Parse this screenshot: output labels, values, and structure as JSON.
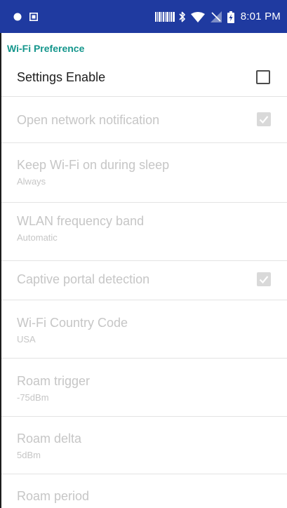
{
  "status_bar": {
    "time": "8:01 PM",
    "icons": [
      "notification-dot-icon",
      "screenshot-icon",
      "barcode-scanner-icon",
      "bluetooth-icon",
      "wifi-icon",
      "no-signal-icon",
      "battery-charging-icon"
    ]
  },
  "colors": {
    "status_bar": "#1f3aa0",
    "accent": "#14968c",
    "disabled_text": "#c6c6c6",
    "primary_text": "#1d1d1d"
  },
  "section": {
    "header": "Wi-Fi Preference"
  },
  "settings_enable": {
    "label": "Settings Enable",
    "checked": false
  },
  "preferences": {
    "open_network_notification": {
      "title": "Open network notification",
      "checked": true,
      "enabled": false
    },
    "keep_wifi_on": {
      "title": "Keep Wi-Fi on during sleep",
      "summary": "Always",
      "enabled": false
    },
    "wlan_frequency_band": {
      "title": "WLAN frequency band",
      "summary": "Automatic",
      "enabled": false
    },
    "captive_portal_detection": {
      "title": "Captive portal detection",
      "checked": true,
      "enabled": false
    },
    "wifi_country_code": {
      "title": "Wi-Fi Country Code",
      "summary": "USA",
      "enabled": false
    },
    "roam_trigger": {
      "title": "Roam trigger",
      "summary": "-75dBm",
      "enabled": false
    },
    "roam_delta": {
      "title": "Roam delta",
      "summary": "5dBm",
      "enabled": false
    },
    "roam_period": {
      "title": "Roam period",
      "enabled": false
    }
  }
}
